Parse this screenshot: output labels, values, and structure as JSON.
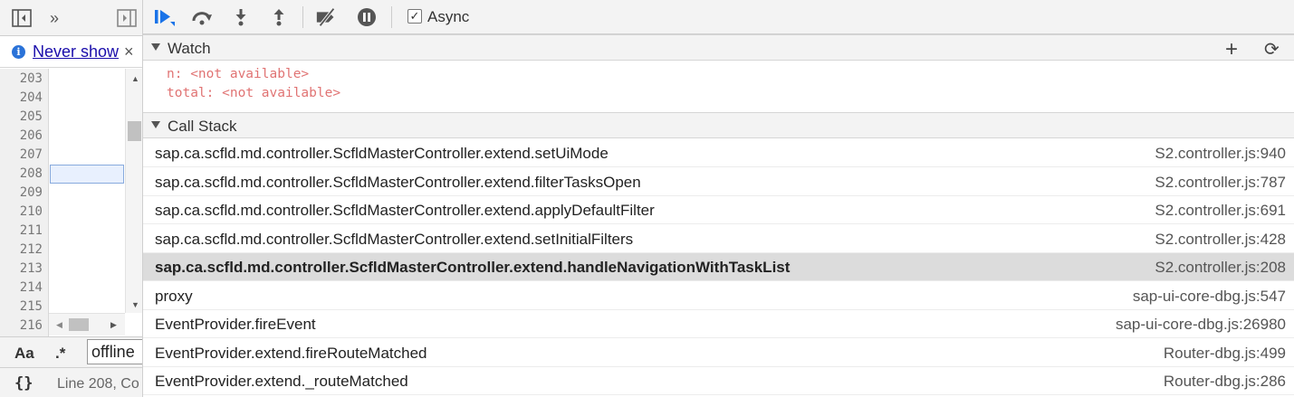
{
  "left_pane": {
    "toolbar": {
      "more_label": "»"
    },
    "infobar": {
      "link_label": "Never show",
      "close_label": "×"
    },
    "line_numbers": [
      "203",
      "204",
      "205",
      "206",
      "207",
      "208",
      "209",
      "210",
      "211",
      "212",
      "213",
      "214",
      "215",
      "216"
    ],
    "current_line_number": "208",
    "search": {
      "match_case_label": "Aa",
      "regex_label": ".*",
      "query_value": "offline"
    },
    "status": {
      "pretty_print_label": "{}",
      "cursor_text": "Line 208, Co"
    }
  },
  "debugger": {
    "toolbar": {
      "async_label": "Async",
      "async_checked": true
    },
    "watch": {
      "title": "Watch",
      "add_label": "+",
      "refresh_label": "⟳",
      "expressions": [
        {
          "name": "n:",
          "value": "<not available>"
        },
        {
          "name": "total:",
          "value": "<not available>"
        }
      ]
    },
    "call_stack": {
      "title": "Call Stack",
      "frames": [
        {
          "name": "sap.ca.scfld.md.controller.ScfldMasterController.extend.setUiMode",
          "location": "S2.controller.js:940",
          "selected": false
        },
        {
          "name": "sap.ca.scfld.md.controller.ScfldMasterController.extend.filterTasksOpen",
          "location": "S2.controller.js:787",
          "selected": false
        },
        {
          "name": "sap.ca.scfld.md.controller.ScfldMasterController.extend.applyDefaultFilter",
          "location": "S2.controller.js:691",
          "selected": false
        },
        {
          "name": "sap.ca.scfld.md.controller.ScfldMasterController.extend.setInitialFilters",
          "location": "S2.controller.js:428",
          "selected": false
        },
        {
          "name": "sap.ca.scfld.md.controller.ScfldMasterController.extend.handleNavigationWithTaskList",
          "location": "S2.controller.js:208",
          "selected": true
        },
        {
          "name": "proxy",
          "location": "sap-ui-core-dbg.js:547",
          "selected": false
        },
        {
          "name": "EventProvider.fireEvent",
          "location": "sap-ui-core-dbg.js:26980",
          "selected": false
        },
        {
          "name": "EventProvider.extend.fireRouteMatched",
          "location": "Router-dbg.js:499",
          "selected": false
        },
        {
          "name": "EventProvider.extend._routeMatched",
          "location": "Router-dbg.js:286",
          "selected": false
        }
      ]
    }
  },
  "colors": {
    "toolbar_bg": "#f3f3f3",
    "resume_blue": "#1a73e8",
    "watch_unavailable": "#c80000",
    "selected_frame_bg": "#dcdcdc"
  }
}
